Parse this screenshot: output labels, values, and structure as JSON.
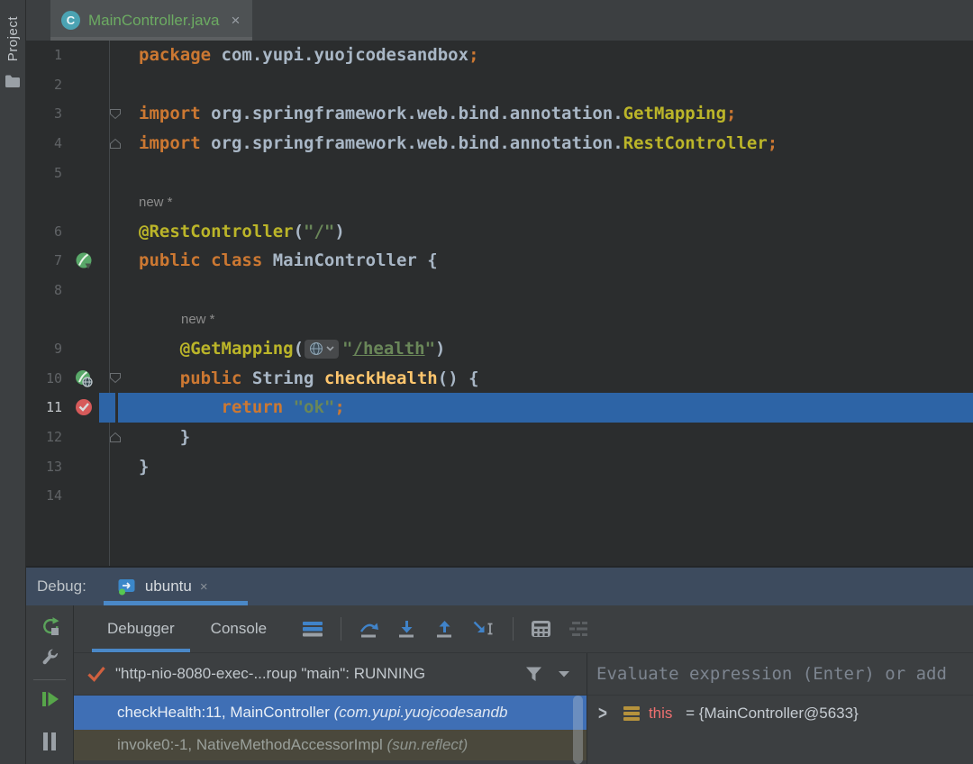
{
  "stripe": {
    "label": "Project"
  },
  "tabbar": {
    "file_icon_letter": "C",
    "title": "MainController.java",
    "close_glyph": "×"
  },
  "editor": {
    "rows": [
      {
        "num": "1",
        "tokens": [
          [
            "kw",
            "package "
          ],
          [
            "pl",
            "com.yupi.yuojcodesandbox"
          ],
          [
            "kw",
            ";"
          ]
        ]
      },
      {
        "num": "2",
        "tokens": []
      },
      {
        "num": "3",
        "fold": "down",
        "tokens": [
          [
            "kw",
            "import "
          ],
          [
            "pl",
            "org.springframework.web.bind.annotation."
          ],
          [
            "ann",
            "GetMapping"
          ],
          [
            "kw",
            ";"
          ]
        ]
      },
      {
        "num": "4",
        "fold": "up",
        "tokens": [
          [
            "kw",
            "import "
          ],
          [
            "pl",
            "org.springframework.web.bind.annotation."
          ],
          [
            "ann",
            "RestController"
          ],
          [
            "kw",
            ";"
          ]
        ]
      },
      {
        "num": "5",
        "tokens": []
      },
      {
        "inlay": "new *",
        "indent": 0
      },
      {
        "num": "6",
        "tokens": [
          [
            "ann",
            "@RestController"
          ],
          [
            "pl",
            "("
          ],
          [
            "str",
            "\"/\""
          ],
          [
            "pl",
            ")"
          ]
        ]
      },
      {
        "num": "7",
        "icon": "spring-run",
        "tokens": [
          [
            "kw",
            "public class "
          ],
          [
            "pl",
            "MainController {"
          ]
        ]
      },
      {
        "num": "8",
        "tokens": []
      },
      {
        "inlay": "new *",
        "indent": 1
      },
      {
        "num": "9",
        "tokens": [
          [
            "ann",
            "    @GetMapping"
          ],
          [
            "pl",
            "("
          ],
          [
            "chip",
            ""
          ],
          [
            "str",
            "\""
          ],
          [
            "strU",
            "/health"
          ],
          [
            "str",
            "\""
          ],
          [
            "pl",
            ")"
          ]
        ]
      },
      {
        "num": "10",
        "icon": "spring-mapping",
        "fold": "down",
        "tokens": [
          [
            "kw",
            "    public "
          ],
          [
            "pl",
            "String "
          ],
          [
            "meth",
            "checkHealth"
          ],
          [
            "pl",
            "() {"
          ]
        ]
      },
      {
        "num": "11",
        "icon": "breakpoint",
        "exec": true,
        "tokens": [
          [
            "kw",
            "        return "
          ],
          [
            "str",
            "\"ok\""
          ],
          [
            "kw",
            ";"
          ]
        ]
      },
      {
        "num": "12",
        "fold": "up",
        "tokens": [
          [
            "pl",
            "    }"
          ]
        ]
      },
      {
        "num": "13",
        "tokens": [
          [
            "pl",
            "}"
          ]
        ]
      },
      {
        "num": "14",
        "tokens": []
      }
    ]
  },
  "debug": {
    "header_label": "Debug:",
    "session_tab": {
      "label": "ubuntu",
      "close_glyph": "×"
    },
    "tool_tabs": [
      {
        "label": "Debugger"
      },
      {
        "label": "Console"
      }
    ],
    "toolbar_icons": [
      "frames-view",
      "step-over",
      "step-into",
      "step-out",
      "run-to-cursor",
      "evaluate-expression",
      "mute-breakpoints"
    ],
    "left_toolbar_icons": [
      "rerun",
      "settings-wrench",
      "resume",
      "pause"
    ],
    "thread_status": "\"http-nio-8080-exec-...roup \"main\": RUNNING",
    "frames": [
      {
        "text": "checkHealth:11, MainController ",
        "pkg": "(com.yupi.yuojcodesandb",
        "state": "selected"
      },
      {
        "text": "invoke0:-1, NativeMethodAccessorImpl ",
        "pkg": "(sun.reflect)",
        "state": "library"
      }
    ],
    "evaluate_placeholder": "Evaluate expression (Enter) or add",
    "variables": [
      {
        "name": "this",
        "rest": " = {MainController@5633}"
      }
    ]
  },
  "colors": {
    "accent_blue": "#4a88c7",
    "exec_line_blue": "#2d64a6",
    "selected_frame_blue": "#3f6fb5",
    "breakpoint_red": "#d65a5a",
    "spring_green": "#59a869",
    "keyword_orange": "#cc7832",
    "annotation_yellow": "#bbb529",
    "string_green": "#6a8759",
    "method_yellow": "#ffc66d"
  }
}
